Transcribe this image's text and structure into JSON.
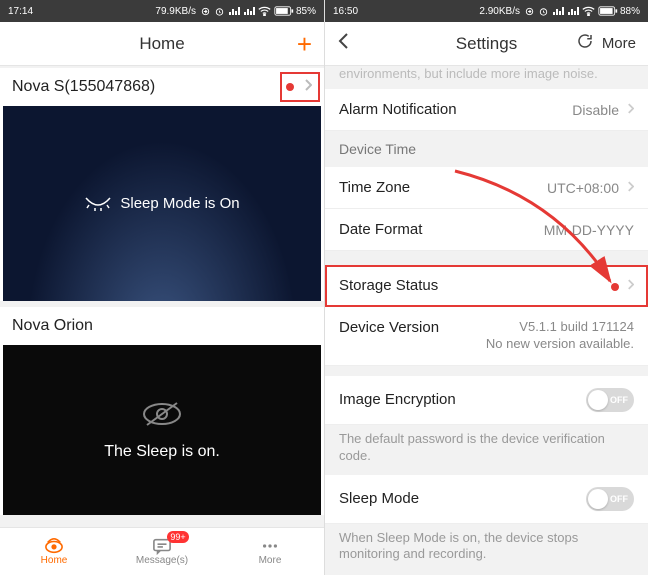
{
  "left": {
    "status": {
      "time": "17:14",
      "net": "79.9KB/s",
      "battery": "85%"
    },
    "title": "Home",
    "add_label": "+",
    "devices": [
      {
        "name": "Nova S(155047868)",
        "overlay": "Sleep Mode is On"
      },
      {
        "name": "Nova Orion",
        "overlay": "The Sleep is on."
      }
    ],
    "tabs": {
      "home": "Home",
      "messages": "Message(s)",
      "more": "More",
      "badge": "99+"
    }
  },
  "right": {
    "status": {
      "time": "16:50",
      "net": "2.90KB/s",
      "battery": "88%"
    },
    "title": "Settings",
    "more_label": "More",
    "truncated_top": "environments, but include more image noise.",
    "rows": {
      "alarm": {
        "label": "Alarm Notification",
        "value": "Disable"
      },
      "device_time_header": "Device Time",
      "timezone": {
        "label": "Time Zone",
        "value": "UTC+08:00"
      },
      "dateformat": {
        "label": "Date Format",
        "value": "MM-DD-YYYY"
      },
      "storage": {
        "label": "Storage Status"
      },
      "version": {
        "label": "Device Version",
        "value": "V5.1.1 build 171124",
        "note": "No new version available."
      },
      "encryption": {
        "label": "Image Encryption",
        "toggle": "OFF"
      },
      "encryption_note": "The default password is the device verification code.",
      "sleep": {
        "label": "Sleep Mode",
        "toggle": "OFF"
      },
      "sleep_note": "When Sleep Mode is on, the device stops monitoring and recording."
    }
  }
}
